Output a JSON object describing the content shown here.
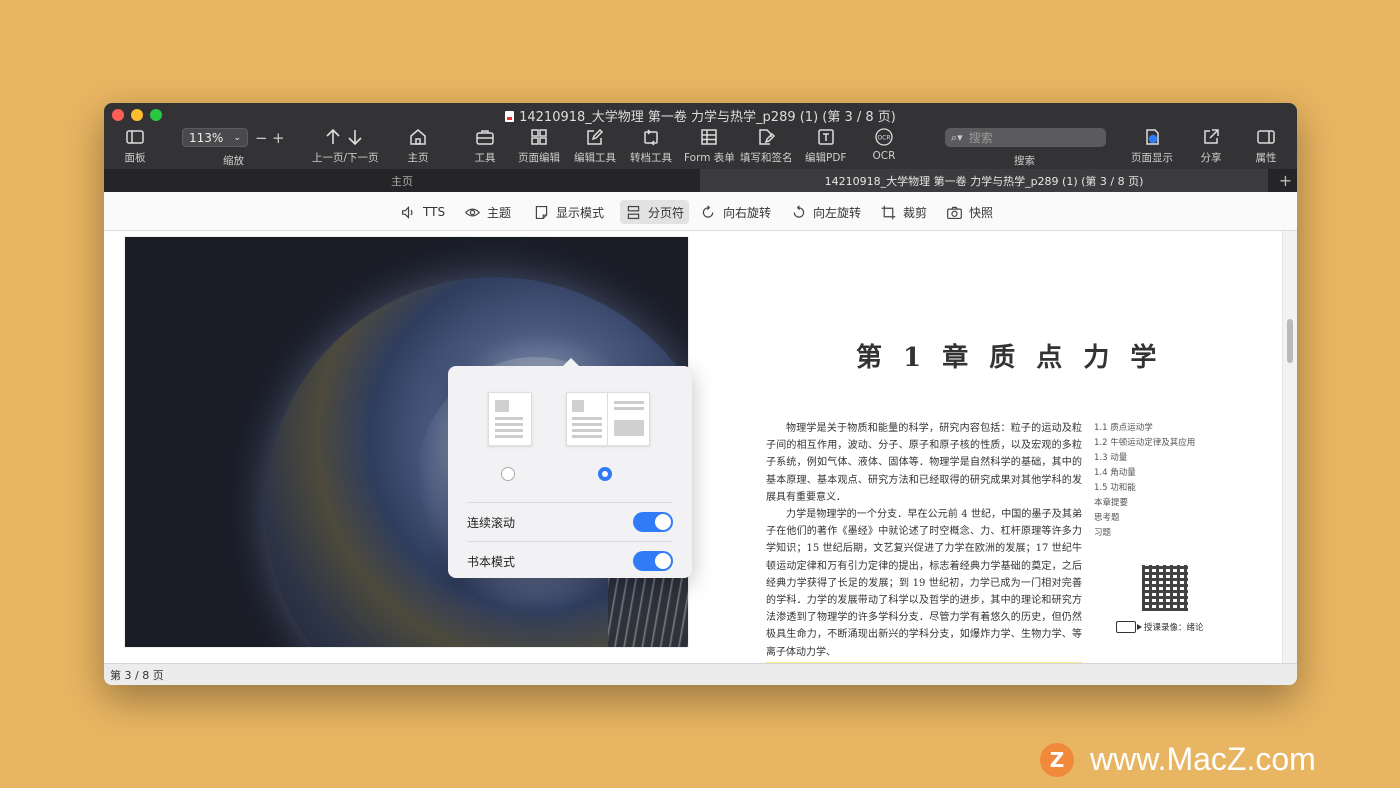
{
  "window": {
    "title": "14210918_大学物理  第一卷  力学与热学_p289 (1) (第 3 / 8 页)"
  },
  "toolbar": {
    "panel": "面板",
    "zoom_value": "113%",
    "zoom_label": "缩放",
    "zoom_minus": "−",
    "zoom_plus": "+",
    "prev_next": "上一页/下一页",
    "home": "主页",
    "tools": "工具",
    "page_edit": "页面编辑",
    "edit_tools": "编辑工具",
    "convert_tools": "转档工具",
    "form": "Form 表单",
    "fill_sign": "填写和签名",
    "edit_pdf": "编辑PDF",
    "ocr": "OCR",
    "search_placeholder": "搜索",
    "search_label": "搜索",
    "page_display": "页面显示",
    "share": "分享",
    "properties": "属性"
  },
  "tabs": {
    "home": "主页",
    "doc": "14210918_大学物理  第一卷  力学与热学_p289 (1) (第 3 / 8 页)",
    "add": "+"
  },
  "subtoolbar": {
    "tts": "TTS",
    "theme": "主题",
    "display_mode": "显示模式",
    "page_break": "分页符",
    "rotate_right": "向右旋转",
    "rotate_left": "向左旋转",
    "crop": "裁剪",
    "snapshot": "快照"
  },
  "popover": {
    "continuous_scroll": "连续滚动",
    "book_mode": "书本模式"
  },
  "page": {
    "chapter_title": "第 1 章   质 点 力 学",
    "para1": "物理学是关于物质和能量的科学，研究内容包括：粒子的运动及粒子间的相互作用，波动、分子、原子和原子核的性质，以及宏观的多粒子系统，例如气体、液体、固体等．物理学是自然科学的基础，其中的基本原理、基本观点、研究方法和已经取得的研究成果对其他学科的发展具有重要意义．",
    "para2": "力学是物理学的一个分支．早在公元前 4 世纪，中国的墨子及其弟子在他们的著作《墨经》中就论述了时空概念、力、杠杆原理等许多力学知识；15 世纪后期，文艺复兴促进了力学在欧洲的发展；17 世纪牛顿运动定律和万有引力定律的提出，标志着经典力学基础的奠定，之后经典力学获得了长足的发展；到 19 世纪初，力学已成为一门相对完善的学科．力学的发展带动了科学以及哲学的进步，其中的理论和研究方法渗透到了物理学的许多学科分支．尽管力学有着悠久的历史，但仍然极具生命力，不断涌现出新兴的学科分支，如爆炸力学、生物力学、等离子体动力学、",
    "toc": [
      "1.1   质点运动学",
      "1.2   牛顿运动定律及其应用",
      "1.3   动量",
      "1.4   角动量",
      "1.5   功和能",
      "本章提要",
      "思考题",
      "习题"
    ],
    "video_label": "授课录像：绪论"
  },
  "status": {
    "page_info": "第 3 / 8 页"
  },
  "watermark": {
    "logo_letter": "Z",
    "text": "www.MacZ.com"
  },
  "colors": {
    "accent": "#2f7cf6",
    "background": "#e8b562",
    "titlebar": "#333336"
  }
}
